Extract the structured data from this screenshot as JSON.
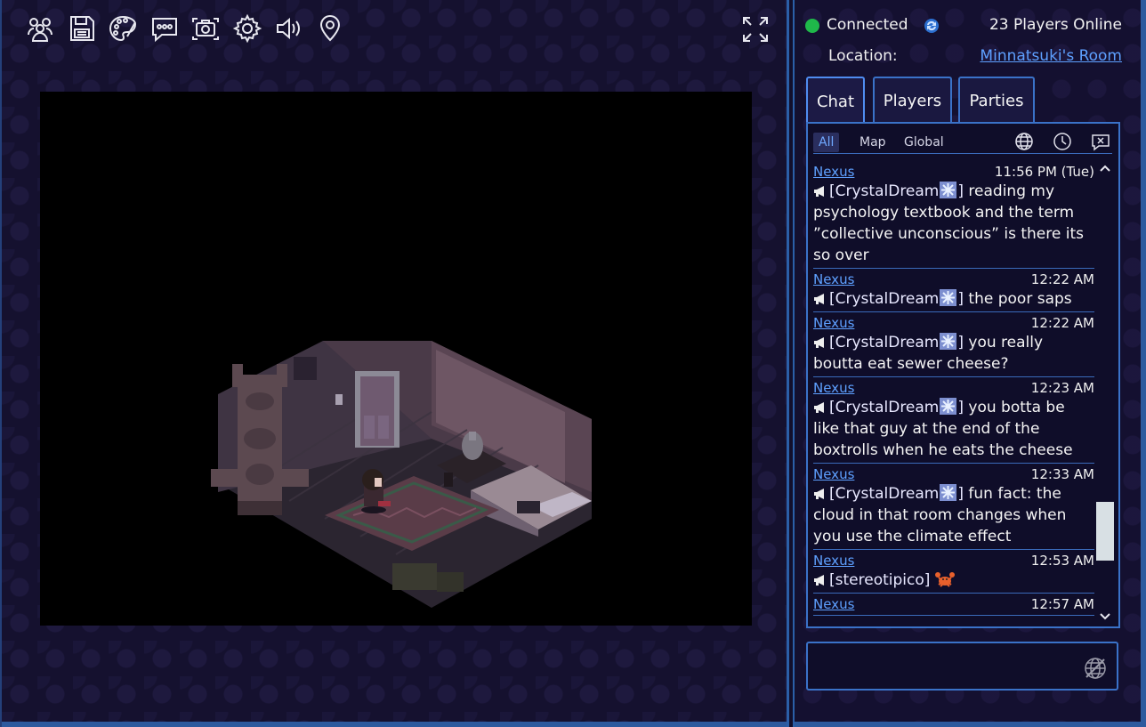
{
  "toolbar": {
    "icons": [
      "players-icon",
      "save-icon",
      "palette-icon",
      "chat-bubble-icon",
      "screenshot-icon",
      "settings-icon",
      "volume-icon",
      "location-pin-icon"
    ],
    "fullscreen_icon": "fullscreen-icon"
  },
  "status": {
    "connection": "Connected",
    "connection_color": "#1fb84a",
    "players_online": "23 Players Online",
    "location_label": "Location:",
    "location_value": "Minnatsuki's Room"
  },
  "tabs": [
    {
      "label": "Chat",
      "active": true
    },
    {
      "label": "Players",
      "active": false
    },
    {
      "label": "Parties",
      "active": false
    }
  ],
  "chat_filters": [
    {
      "label": "All",
      "active": true
    },
    {
      "label": "Map",
      "active": false
    },
    {
      "label": "Global",
      "active": false
    }
  ],
  "messages": [
    {
      "sender": "Nexus",
      "time": "11:56 PM (Tue)",
      "user": "CrystalDream",
      "text": "reading my psychology textbook and the term ”collective unconscious” is there its so over"
    },
    {
      "sender": "Nexus",
      "time": "12:22 AM",
      "user": "CrystalDream",
      "text": "the poor saps"
    },
    {
      "sender": "Nexus",
      "time": "12:22 AM",
      "user": "CrystalDream",
      "text": "you really boutta eat sewer cheese?"
    },
    {
      "sender": "Nexus",
      "time": "12:23 AM",
      "user": "CrystalDream",
      "text": "you botta be like that guy at the end of the boxtrolls when he eats the cheese"
    },
    {
      "sender": "Nexus",
      "time": "12:33 AM",
      "user": "CrystalDream",
      "text": "fun fact: the cloud in that room changes when you use the climate effect"
    },
    {
      "sender": "Nexus",
      "time": "12:53 AM",
      "user": "stereotipico",
      "text": ""
    },
    {
      "sender": "Nexus",
      "time": "12:57 AM",
      "user": "",
      "text": ""
    }
  ],
  "colors": {
    "link": "#5ea0ff",
    "border_accent": "#3a72c8",
    "panel_bg": "#141030"
  }
}
